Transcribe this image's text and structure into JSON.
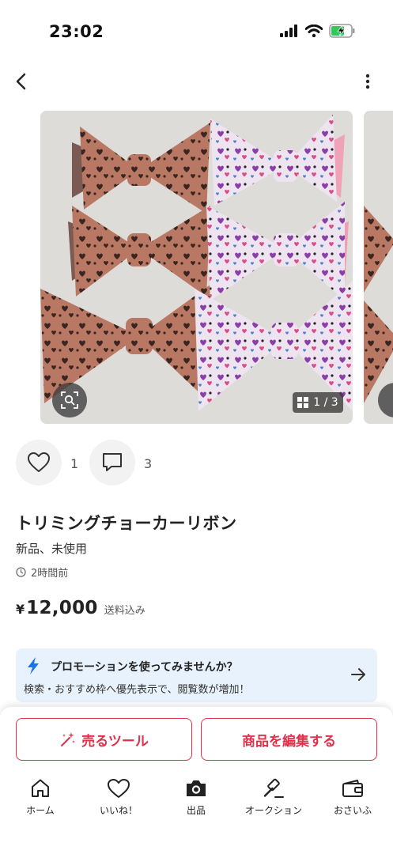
{
  "status_bar": {
    "time": "23:02"
  },
  "gallery": {
    "counter": "1 / 3"
  },
  "actions": {
    "like_count": "1",
    "comment_count": "3"
  },
  "item": {
    "title": "トリミングチョーカーリボン",
    "condition": "新品、未使用",
    "posted": "2時間前",
    "currency": "¥",
    "price": "12,000",
    "shipping": "送料込み"
  },
  "promo": {
    "title": "プロモーションを使ってみませんか？",
    "description": "検索・おすすめ枠へ優先表示で、閲覧数が増加！"
  },
  "buttons": {
    "sell_tool": "売るツール",
    "edit_item": "商品を編集する"
  },
  "tabs": [
    {
      "label": "ホーム",
      "icon": "home-icon"
    },
    {
      "label": "いいね！",
      "icon": "heart-icon"
    },
    {
      "label": "出品",
      "icon": "camera-icon"
    },
    {
      "label": "オークション",
      "icon": "gavel-icon"
    },
    {
      "label": "おさいふ",
      "icon": "wallet-icon"
    }
  ],
  "colors": {
    "accent": "#e0304a",
    "promo_bg": "#e8f2fc",
    "promo_icon": "#1a73e8",
    "battery": "#34c759"
  }
}
